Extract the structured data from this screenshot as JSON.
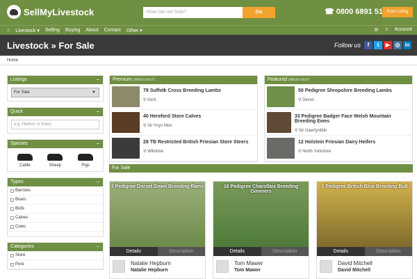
{
  "header": {
    "logo_text": "SellMyLivestock",
    "search_placeholder": "How can we help?",
    "search_button": "Go",
    "phone": "☎ 0800 6891 517",
    "post_listing": "Post Listing"
  },
  "nav": {
    "items": [
      "Livestock ▾",
      "Selling",
      "Buying",
      "About",
      "Contact",
      "Other ▾"
    ],
    "account": "Account"
  },
  "page": {
    "title": "Livestock » For Sale",
    "follow": "Follow us",
    "breadcrumb": "Home"
  },
  "sidebar": {
    "listings_title": "Listings",
    "listings_value": "For Sale",
    "quick_title": "Quick",
    "quick_placeholder": "e.g. Heifers or Ewes",
    "species_title": "Species",
    "species": [
      "Cattle",
      "Sheep",
      "Pigs"
    ],
    "types_title": "Types",
    "types": [
      "Barrows",
      "Boars",
      "Bulls",
      "Calves",
      "Cows"
    ],
    "categories_title": "Categories",
    "categories": [
      "Store",
      "Pure"
    ]
  },
  "premium": {
    "title": "Premium",
    "whats": "(What's this?)",
    "items": [
      {
        "title": "78 Suffolk Cross Breeding Lambs",
        "location": "Kent"
      },
      {
        "title": "40 Hereford Store Calves",
        "location": "Sir Ynys Mon"
      },
      {
        "title": "28 TB Restricted British Friesian Store Steers",
        "location": "Wiltshire"
      }
    ]
  },
  "featured": {
    "title": "Featured",
    "whats": "(What's this?)",
    "items": [
      {
        "title": "50 Pedigree Shropshire Breeding Lambs",
        "location": "Devon"
      },
      {
        "title": "33 Pedigree Badger Face Welsh Mountain Breeding Ewes",
        "location": "Sir Gaerfyrddin"
      },
      {
        "title": "12 Holstein Friesian Dairy Heifers",
        "location": "North Yorkshire"
      }
    ]
  },
  "forsale": {
    "title": "For Sale",
    "cards": [
      {
        "title": "3 Pedigree Dorset Down Breeding Rams",
        "details": "Details",
        "description": "Description",
        "seller": "Natalie Hepburn",
        "seller_bold": "Natalie Hepburn"
      },
      {
        "title": "16 Pedigree Charollais Breeding Gimmers",
        "details": "Details",
        "description": "Description",
        "seller": "Tom Mawer",
        "seller_bold": "Tom Mawer"
      },
      {
        "title": "1 Pedigree British Blue Breeding Bull",
        "details": "Details",
        "description": "Description",
        "seller": "David Mitchell",
        "seller_bold": "David Mitchell"
      }
    ]
  },
  "colors": {
    "green": "#6f8f43",
    "orange": "#f3a22b",
    "dark": "#3a3a3a"
  }
}
